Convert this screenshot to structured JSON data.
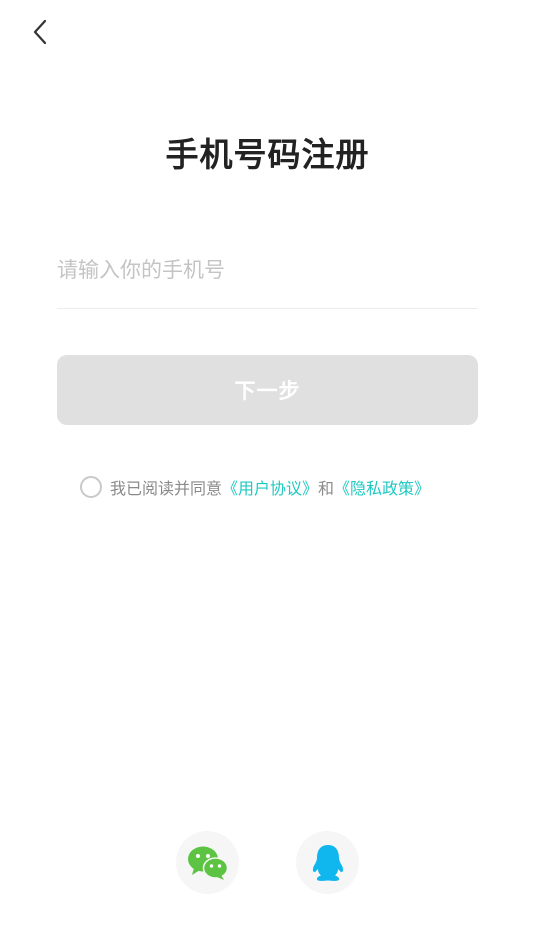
{
  "header": {
    "back_icon": "chevron-left-icon"
  },
  "title": "手机号码注册",
  "phone": {
    "placeholder": "请输入你的手机号",
    "value": ""
  },
  "next_button": {
    "label": "下一步",
    "enabled": false
  },
  "agreement": {
    "checked": false,
    "prefix": "我已阅读并同意",
    "user_agreement": "《用户协议》",
    "conjunction": "和",
    "privacy_policy": "《隐私政策》"
  },
  "social_login": [
    {
      "name": "wechat",
      "icon": "wechat-icon",
      "color": "#5cc343"
    },
    {
      "name": "qq",
      "icon": "qq-icon",
      "color": "#0fb7ee"
    }
  ],
  "colors": {
    "accent_link": "#1fc9c2",
    "button_disabled": "#e0e0e0",
    "title_text": "#222222"
  }
}
